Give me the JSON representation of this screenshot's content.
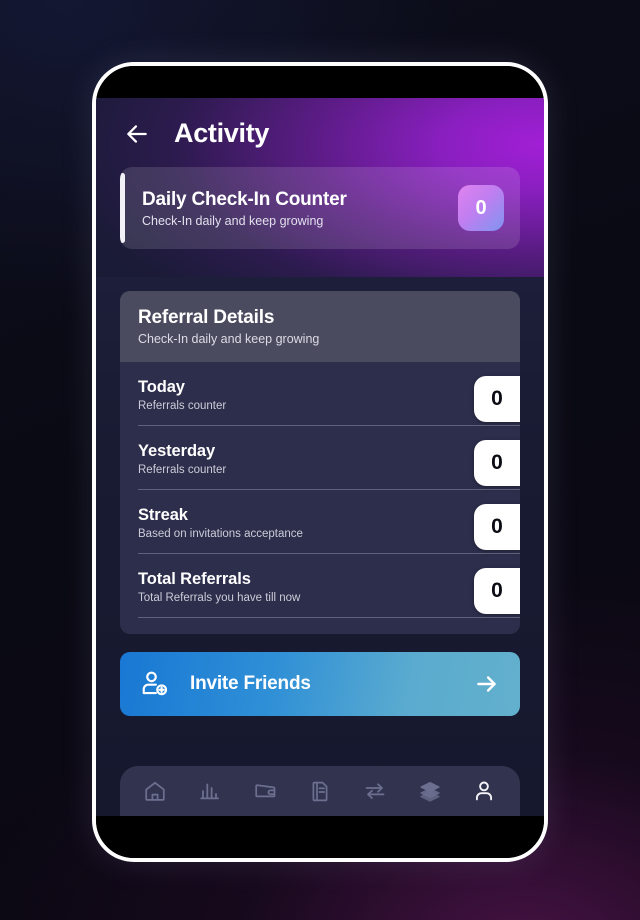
{
  "app": {
    "screen_title": "Activity",
    "back_icon": "arrow-left-icon"
  },
  "checkin_card": {
    "title": "Daily Check-In Counter",
    "subtitle": "Check-In daily and keep growing",
    "badge_value": "0",
    "badge_gradient_from": "#e083f0",
    "badge_gradient_to": "#7f95f0"
  },
  "referral": {
    "header": {
      "title": "Referral Details",
      "subtitle": "Check-In daily and keep growing"
    },
    "rows": [
      {
        "title": "Today",
        "subtitle": "Referrals counter",
        "value": "0"
      },
      {
        "title": "Yesterday",
        "subtitle": "Referrals counter",
        "value": "0"
      },
      {
        "title": "Streak",
        "subtitle": "Based on invitations acceptance",
        "value": "0"
      },
      {
        "title": "Total Referrals",
        "subtitle": "Total Referrals you have till now",
        "value": "0"
      }
    ]
  },
  "invite": {
    "label": "Invite Friends",
    "leading_icon": "person-add-icon",
    "trailing_icon": "arrow-right-icon",
    "accent_from": "#1878d4",
    "accent_to": "#63b0cd"
  },
  "bottom_nav": {
    "items": [
      {
        "icon": "home-icon",
        "active": false
      },
      {
        "icon": "bar-chart-icon",
        "active": false
      },
      {
        "icon": "wallet-icon",
        "active": false
      },
      {
        "icon": "document-icon",
        "active": false
      },
      {
        "icon": "transfer-icon",
        "active": false
      },
      {
        "icon": "layers-icon",
        "active": false
      },
      {
        "icon": "person-icon",
        "active": true
      }
    ],
    "active_color": "#f4f4fa",
    "inactive_color": "#6d6f91"
  },
  "theme": {
    "header_purple": "#8a1fc0",
    "panel_bg": "#2c2e4b",
    "panel_head_bg": "#4b4b60",
    "screen_bg": "#191b33"
  }
}
